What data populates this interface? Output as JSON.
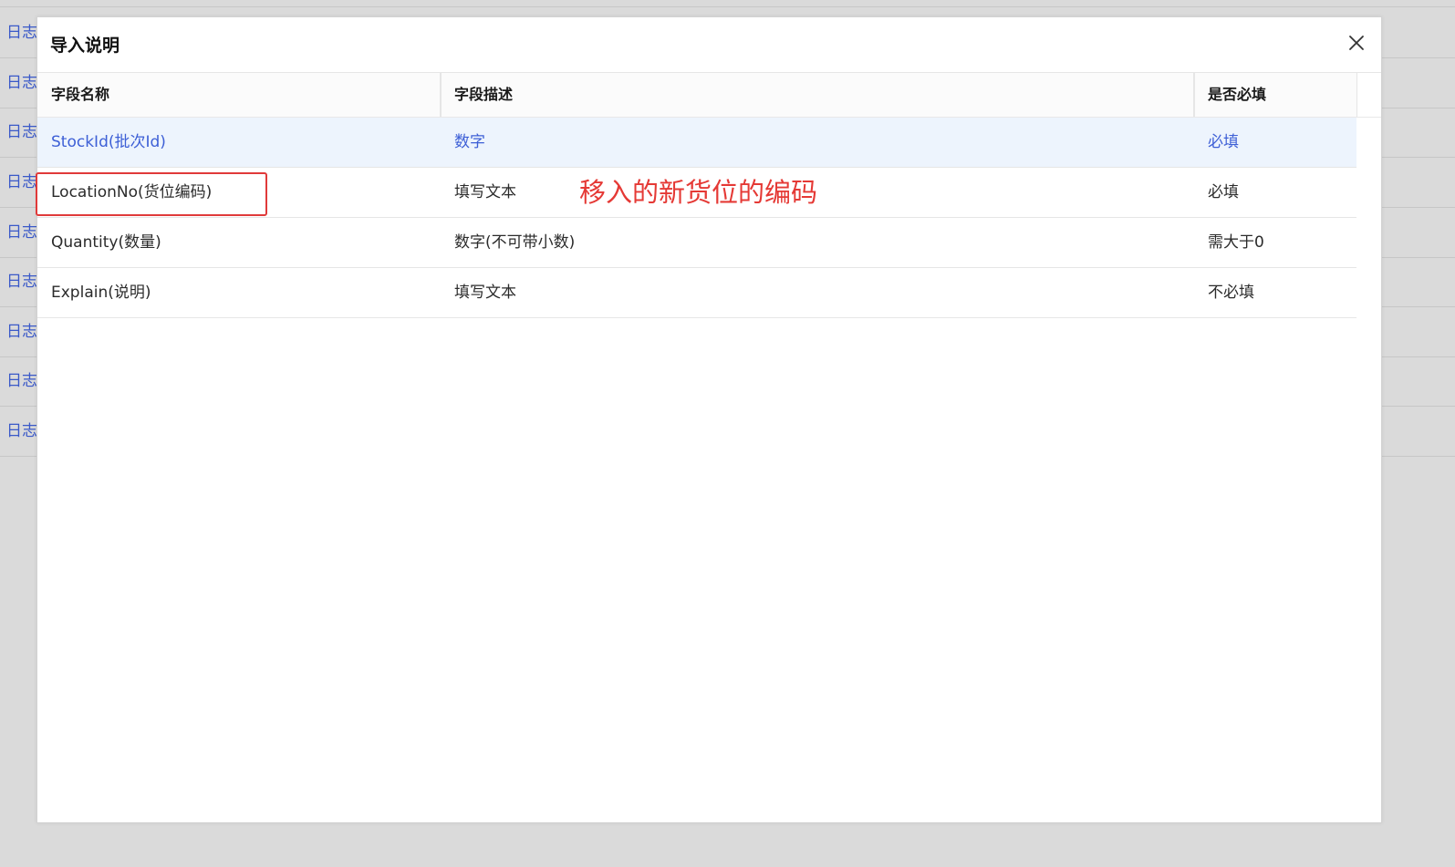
{
  "background": {
    "row_links": [
      "日志",
      "日志",
      "日志",
      "日志",
      "日志",
      "日志",
      "日志",
      "日志",
      "日志"
    ]
  },
  "modal": {
    "title": "导入说明",
    "close_icon": "close-icon"
  },
  "table": {
    "headers": [
      "字段名称",
      "字段描述",
      "是否必填"
    ],
    "rows": [
      {
        "name": "StockId(批次Id)",
        "desc": "数字",
        "required": "必填",
        "selected": true
      },
      {
        "name": "LocationNo(货位编码)",
        "desc": "填写文本",
        "required": "必填",
        "selected": false
      },
      {
        "name": "Quantity(数量)",
        "desc": "数字(不可带小数)",
        "required": "需大于0",
        "selected": false
      },
      {
        "name": "Explain(说明)",
        "desc": "填写文本",
        "required": "不必填",
        "selected": false
      }
    ]
  },
  "annotation": {
    "text": "移入的新货位的编码",
    "color": "#e53935"
  },
  "colors": {
    "selected_row_bg": "#edf4fd",
    "selected_text": "#3d5fd6",
    "link": "#3a59c8"
  }
}
